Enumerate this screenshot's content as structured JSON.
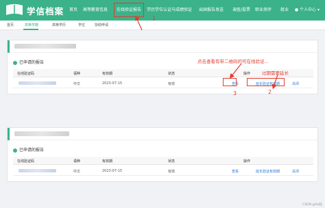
{
  "header": {
    "logo_icon": "bookmark-icon",
    "app_title": "学信档案",
    "nav": [
      "首页",
      "高等教育信息",
      "在线验证报告",
      "学历学位认证与成绩验证",
      "出国报告发送",
      "调查/投票",
      "职业测评",
      "就业"
    ],
    "active_nav_index": 2,
    "user_icon": "user-icon",
    "user_label": "个人中心"
  },
  "subnav": {
    "items": [
      "首页",
      "高等学籍",
      "高等学历",
      "学位",
      "协助申请"
    ],
    "active_index": 1
  },
  "cards": [
    {
      "section_title": "已申请的报告",
      "columns": [
        "在线验证码",
        "语种",
        "有效期",
        "状态",
        "操作"
      ],
      "row": {
        "language": "中文",
        "expiry": "2023-07-15",
        "status": "有效",
        "view": "查看",
        "extend": "延长验证有效期",
        "close": "关闭"
      }
    },
    {
      "section_title": "已申请的报告",
      "columns": [
        "在线验证码",
        "语种",
        "有效期",
        "状态",
        "操作"
      ],
      "row": {
        "language": "中文",
        "expiry": "2023-07-15",
        "status": "有效",
        "view": "查看",
        "extend": "延长验证有效期",
        "close": "关闭"
      }
    }
  ],
  "annotations": {
    "click_view": "点击查看有带二维码的可在线验证...",
    "expired_extend": "过期需要延长",
    "n1": "1",
    "n2": "2",
    "n3": "3"
  },
  "colors": {
    "brand": "#3bb289",
    "annotation": "#e23b2e",
    "link": "#2a7ad6"
  },
  "watermark": "CSDN @fei起"
}
